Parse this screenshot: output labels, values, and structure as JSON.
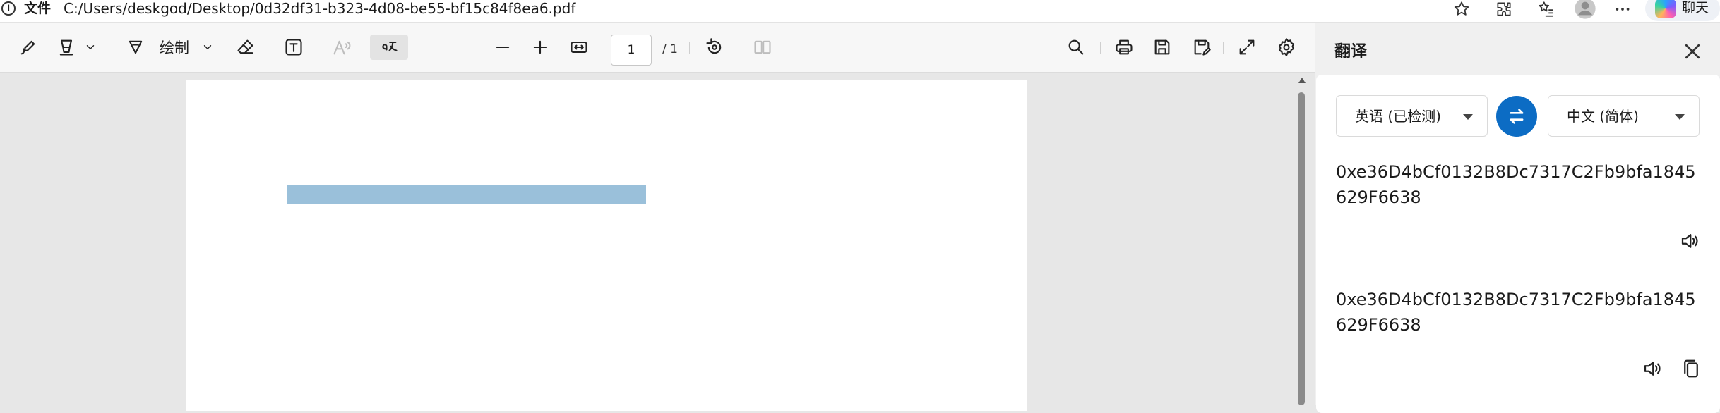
{
  "address_bar": {
    "file_label": "文件",
    "url": "C:/Users/deskgod/Desktop/0d32df31-b323-4d08-be55-bf15c84f8ea6.pdf",
    "chat_label": "聊天"
  },
  "toolbar": {
    "draw_label": "绘制",
    "page_current": "1",
    "page_total": "/ 1"
  },
  "translate_panel": {
    "title": "翻译",
    "source_language": "英语 (已检测)",
    "target_language": "中文 (简体)",
    "source_text": "0xe36D4bCf0132B8Dc7317C2Fb9bfa1845629F6638",
    "translated_text": "0xe36D4bCf0132B8Dc7317C2Fb9bfa1845629F6638"
  },
  "colors": {
    "accent": "#0c6cc4",
    "highlight": "#9ac0da",
    "panel_bg": "#f0f0f0",
    "doc_bg": "#e7e7e7"
  }
}
